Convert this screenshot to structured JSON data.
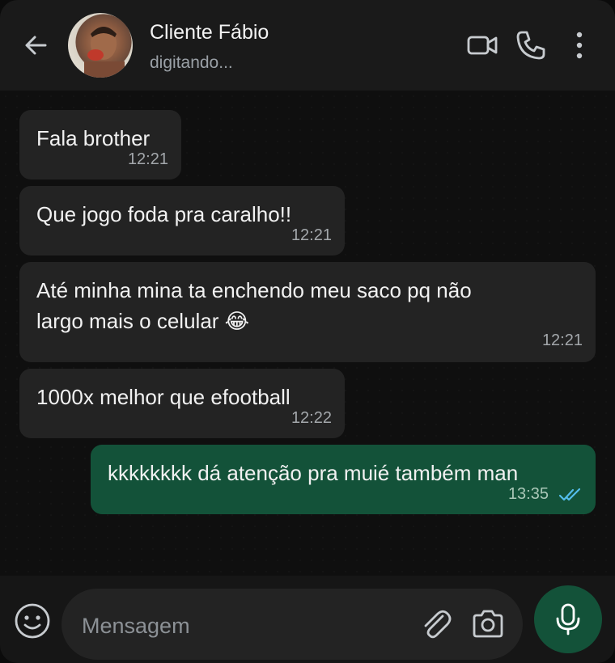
{
  "header": {
    "contact_name": "Cliente Fábio",
    "status": "digitando...",
    "icons": [
      "back-arrow-icon",
      "video-call-icon",
      "phone-icon",
      "more-options-icon"
    ]
  },
  "messages": [
    {
      "direction": "in",
      "lines": [
        "Fala brother"
      ],
      "time": "12:21"
    },
    {
      "direction": "in",
      "lines": [
        "Que jogo foda pra caralho!!"
      ],
      "time": "12:21"
    },
    {
      "direction": "in",
      "lines": [
        "Até minha mina ta enchendo meu saco pq não",
        "largo mais o celular 😂"
      ],
      "time": "12:21"
    },
    {
      "direction": "in",
      "lines": [
        "1000x melhor que efootball"
      ],
      "time": "12:22"
    },
    {
      "direction": "out",
      "lines": [
        "kkkkkkkk dá atenção pra muié também man"
      ],
      "time": "13:35",
      "read": true
    }
  ],
  "footer": {
    "placeholder": "Mensagem",
    "icons": [
      "emoji-icon",
      "attach-icon",
      "camera-icon",
      "mic-icon"
    ]
  },
  "colors": {
    "header_bg": "#1a1a1a",
    "incoming_bubble": "#232323",
    "outgoing_bubble": "#135239",
    "read_ticks": "#53bdeb",
    "icon": "#c7cbcf"
  }
}
